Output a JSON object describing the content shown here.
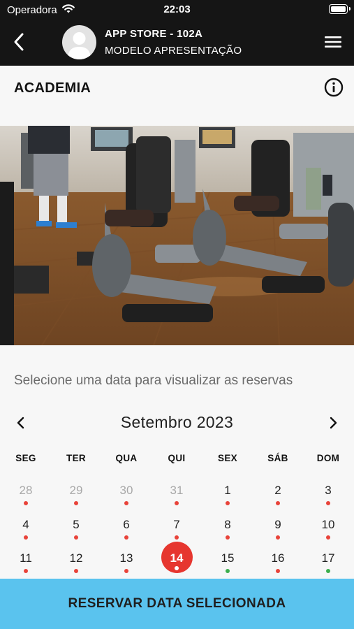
{
  "status_bar": {
    "carrier": "Operadora",
    "time": "22:03"
  },
  "header": {
    "title": "APP STORE - 102A",
    "subtitle": "MODELO APRESENTAÇÃO"
  },
  "section": {
    "title": "ACADEMIA"
  },
  "instruction": "Selecione uma data para visualizar as reservas",
  "calendar": {
    "month_label": "Setembro 2023",
    "weekdays": [
      "SEG",
      "TER",
      "QUA",
      "QUI",
      "SEX",
      "SÁB",
      "DOM"
    ],
    "weeks": [
      [
        {
          "day": "28",
          "other_month": true,
          "dot": "red"
        },
        {
          "day": "29",
          "other_month": true,
          "dot": "red"
        },
        {
          "day": "30",
          "other_month": true,
          "dot": "red"
        },
        {
          "day": "31",
          "other_month": true,
          "dot": "red"
        },
        {
          "day": "1",
          "dot": "red"
        },
        {
          "day": "2",
          "dot": "red"
        },
        {
          "day": "3",
          "dot": "red"
        }
      ],
      [
        {
          "day": "4",
          "dot": "red"
        },
        {
          "day": "5",
          "dot": "red"
        },
        {
          "day": "6",
          "dot": "red"
        },
        {
          "day": "7",
          "dot": "red"
        },
        {
          "day": "8",
          "dot": "red"
        },
        {
          "day": "9",
          "dot": "red"
        },
        {
          "day": "10",
          "dot": "red"
        }
      ],
      [
        {
          "day": "11",
          "dot": "red"
        },
        {
          "day": "12",
          "dot": "red"
        },
        {
          "day": "13",
          "dot": "red"
        },
        {
          "day": "14",
          "dot": "red",
          "selected": true
        },
        {
          "day": "15",
          "dot": "green"
        },
        {
          "day": "16",
          "dot": "red"
        },
        {
          "day": "17",
          "dot": "green"
        }
      ]
    ]
  },
  "reserve_button": {
    "label": "RESERVAR DATA SELECIONADA"
  },
  "colors": {
    "header_bg": "#151515",
    "accent_red": "#e6362f",
    "dot_red": "#e8433a",
    "dot_green": "#3cae4d",
    "button_blue": "#5ac3ee"
  },
  "icons": [
    "back-chevron-icon",
    "avatar-person-icon",
    "hamburger-menu-icon",
    "info-icon",
    "chevron-left-icon",
    "chevron-right-icon",
    "wifi-icon",
    "battery-icon"
  ]
}
